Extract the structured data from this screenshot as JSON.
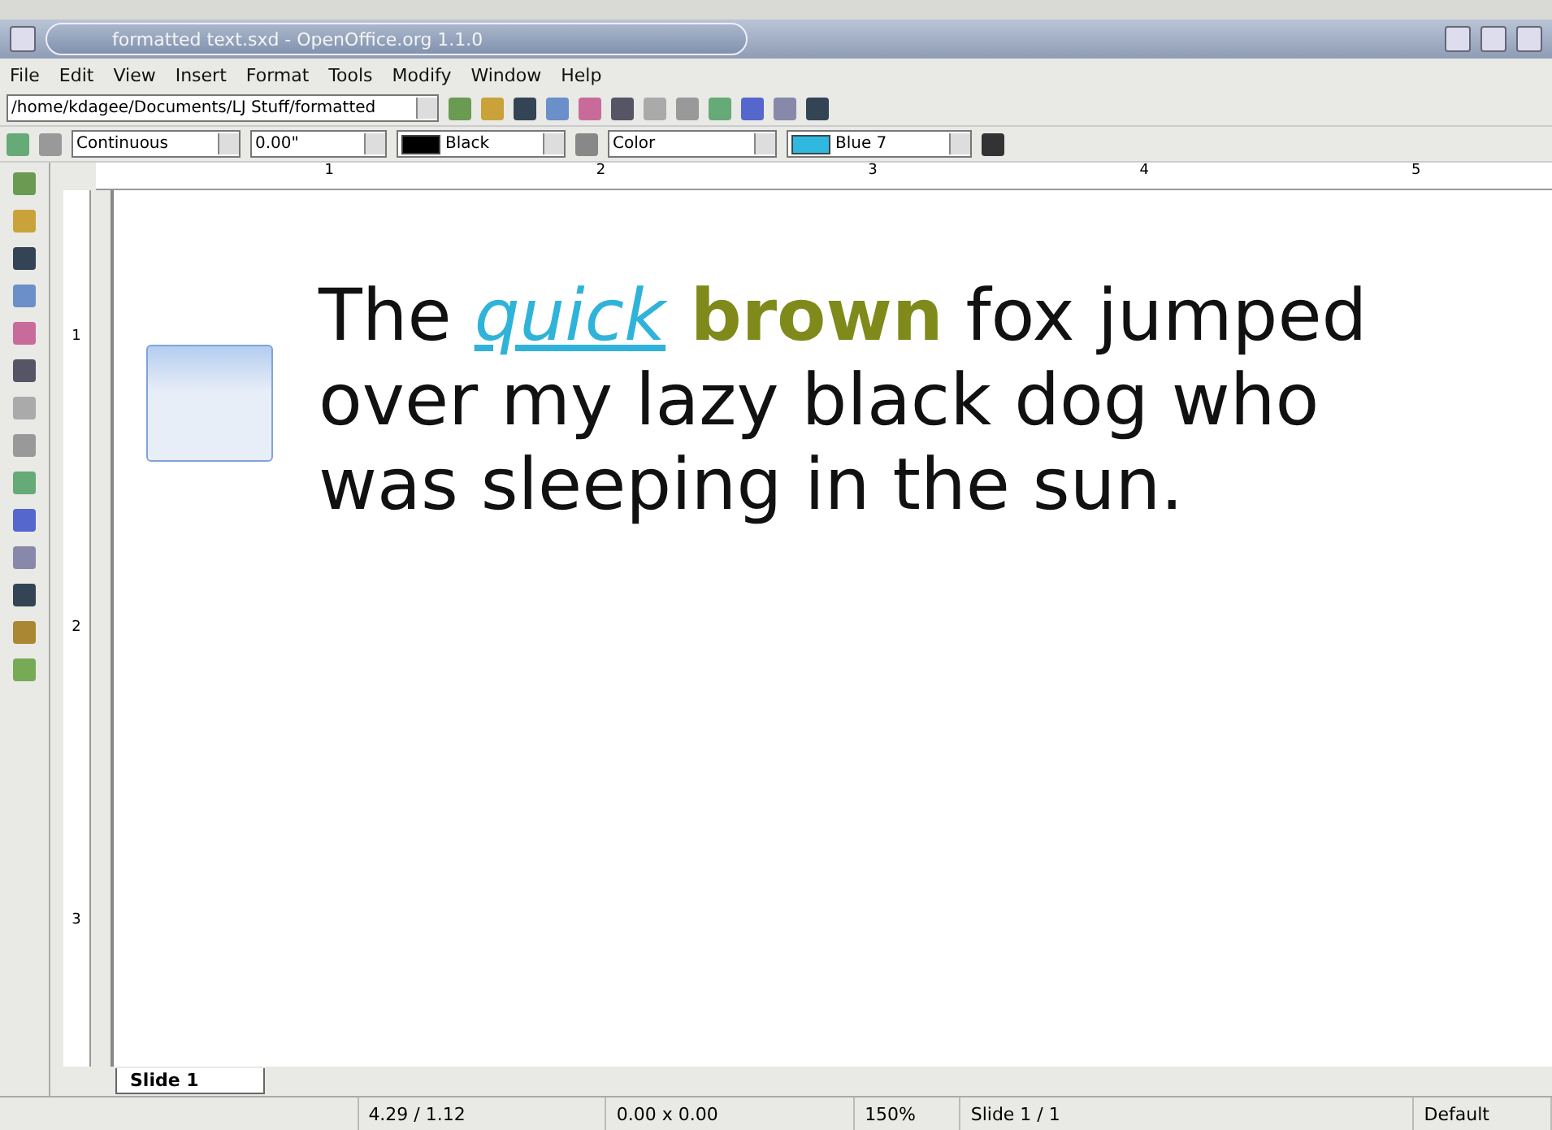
{
  "window": {
    "title": "formatted text.sxd - OpenOffice.org 1.1.0"
  },
  "menu": [
    "File",
    "Edit",
    "View",
    "Insert",
    "Format",
    "Tools",
    "Modify",
    "Window",
    "Help"
  ],
  "function_bar": {
    "path": "/home/kdagee/Documents/LJ Stuff/formatted"
  },
  "object_bar": {
    "line_style": "Continuous",
    "line_width": "0.00\"",
    "line_color": "Black",
    "area_style": "Color",
    "area_color": "Blue 7"
  },
  "ruler": {
    "horizontal": [
      "1",
      "2",
      "3",
      "4",
      "5"
    ],
    "vertical": [
      "1",
      "2",
      "3"
    ]
  },
  "slide_text": [
    {
      "text": "The ",
      "kind": "plain"
    },
    {
      "text": "quick",
      "kind": "link"
    },
    {
      "text": " brown",
      "kind": "bold"
    },
    {
      "text": " fox jumped over my lazy black dog who was sleeping in the sun.",
      "kind": "plain"
    }
  ],
  "slide_tabs": [
    {
      "label": "Slide 1",
      "selected": true
    }
  ],
  "status_bar": {
    "position": "4.29 / 1.12",
    "size": "0.00 x 0.00",
    "zoom": "150%",
    "slide": "Slide 1 / 1",
    "layout": "Default"
  }
}
